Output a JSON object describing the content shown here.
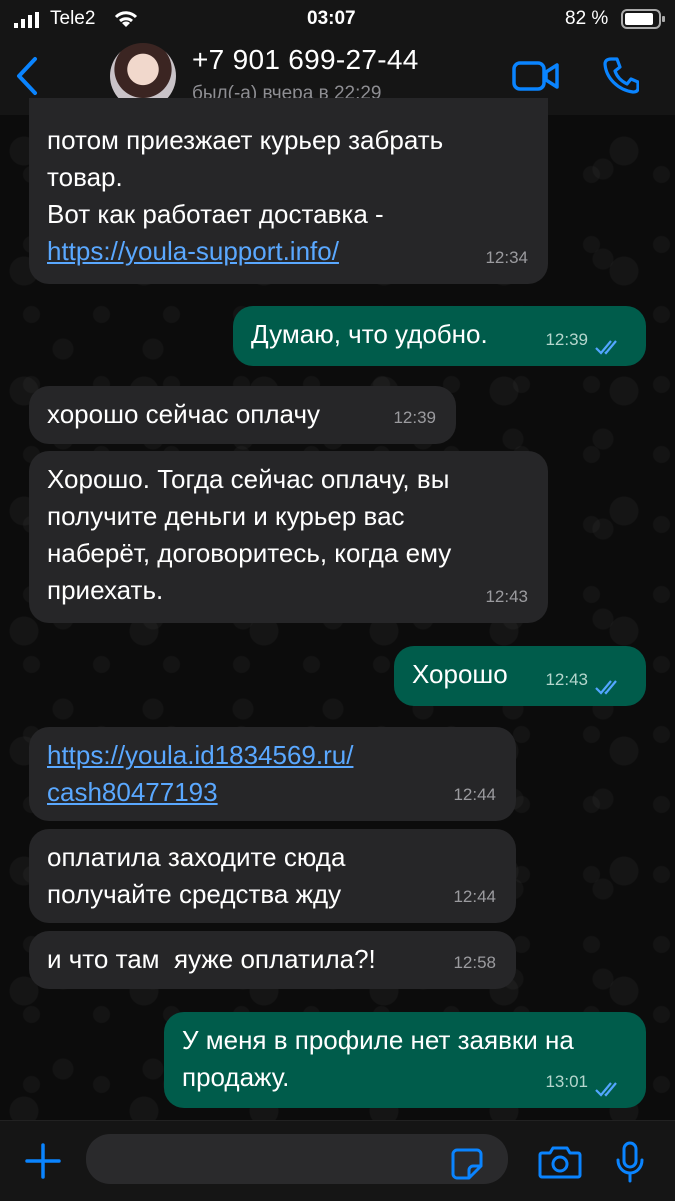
{
  "status_bar": {
    "carrier": "Tele2",
    "time": "03:07",
    "battery": "82 %"
  },
  "header": {
    "contact_name": "+7 901 699-27-44",
    "contact_status": "был(-а) вчера в 22:29",
    "icons": [
      "back-chevron-icon",
      "video-call-icon",
      "phone-call-icon"
    ]
  },
  "messages": [
    {
      "direction": "in",
      "lines": [
        "потом приезжает курьер забрать",
        "товар.",
        "Вот как работает доставка -"
      ],
      "link": "https://youla-support.info/",
      "time": "12:34"
    },
    {
      "direction": "out",
      "text": "Думаю, что удобно.",
      "time": "12:39",
      "status": "read"
    },
    {
      "direction": "in",
      "text": "хорошо сейчас оплачу",
      "time": "12:39"
    },
    {
      "direction": "in",
      "lines": [
        "Хорошо. Тогда сейчас оплачу, вы",
        "получите деньги и курьер вас",
        "наберёт, договоритесь, когда ему",
        "приехать."
      ],
      "time": "12:43"
    },
    {
      "direction": "out",
      "text": "Хорошо",
      "time": "12:43",
      "status": "read"
    },
    {
      "direction": "in",
      "link_lines": [
        "https://youla.id1834569.ru/",
        "cash80477193"
      ],
      "time": "12:44"
    },
    {
      "direction": "in",
      "lines": [
        "оплатила заходите сюда",
        "получайте средства жду"
      ],
      "time": "12:44"
    },
    {
      "direction": "in",
      "text": "и что там  яуже оплатила?!",
      "time": "12:58"
    },
    {
      "direction": "out",
      "lines": [
        "У меня в профиле нет заявки на",
        "продажу."
      ],
      "time": "13:01",
      "status": "read"
    }
  ],
  "input_bar": {
    "placeholder": "",
    "icons": [
      "plus-icon",
      "sticker-icon",
      "camera-icon",
      "microphone-icon"
    ]
  },
  "colors": {
    "accent": "#0a84ff",
    "incoming_bubble": "#262628",
    "outgoing_bubble": "#005c4b",
    "link": "#5aa8ff",
    "read_ticks": "#53a6ff"
  }
}
